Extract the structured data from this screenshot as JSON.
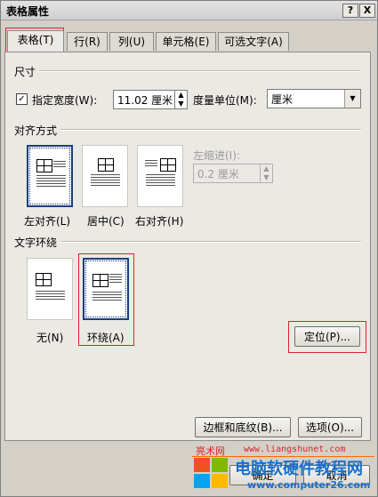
{
  "window": {
    "title": "表格属性",
    "help_label": "?",
    "close_label": "X"
  },
  "tabs": [
    {
      "label": "表格(T)"
    },
    {
      "label": "行(R)"
    },
    {
      "label": "列(U)"
    },
    {
      "label": "单元格(E)"
    },
    {
      "label": "可选文字(A)"
    }
  ],
  "size": {
    "section_label": "尺寸",
    "preferred_width_label": "指定宽度(W):",
    "preferred_width_checked": true,
    "width_value": "11.02 厘米",
    "measure_label": "度量单位(M):",
    "measure_value": "厘米"
  },
  "alignment": {
    "section_label": "对齐方式",
    "options": [
      {
        "label": "左对齐(L)"
      },
      {
        "label": "居中(C)"
      },
      {
        "label": "右对齐(H)"
      }
    ],
    "indent_label": "左缩进(I):",
    "indent_value": "0.2 厘米"
  },
  "wrapping": {
    "section_label": "文字环绕",
    "options": [
      {
        "label": "无(N)"
      },
      {
        "label": "环绕(A)"
      }
    ],
    "positioning_button": "定位(P)..."
  },
  "buttons": {
    "borders_shading": "边框和底纹(B)...",
    "options": "选项(O)...",
    "ok": "确定",
    "cancel": "取消"
  },
  "watermark": {
    "line1": "电脑软硬件教程网",
    "line2": "www.computer26.com",
    "line3": "www.liangshunet.com",
    "brand_partial": "亮术网"
  },
  "colors": {
    "accent_red": "#e0212a",
    "selected_tile_border": "#1b3d7a"
  }
}
